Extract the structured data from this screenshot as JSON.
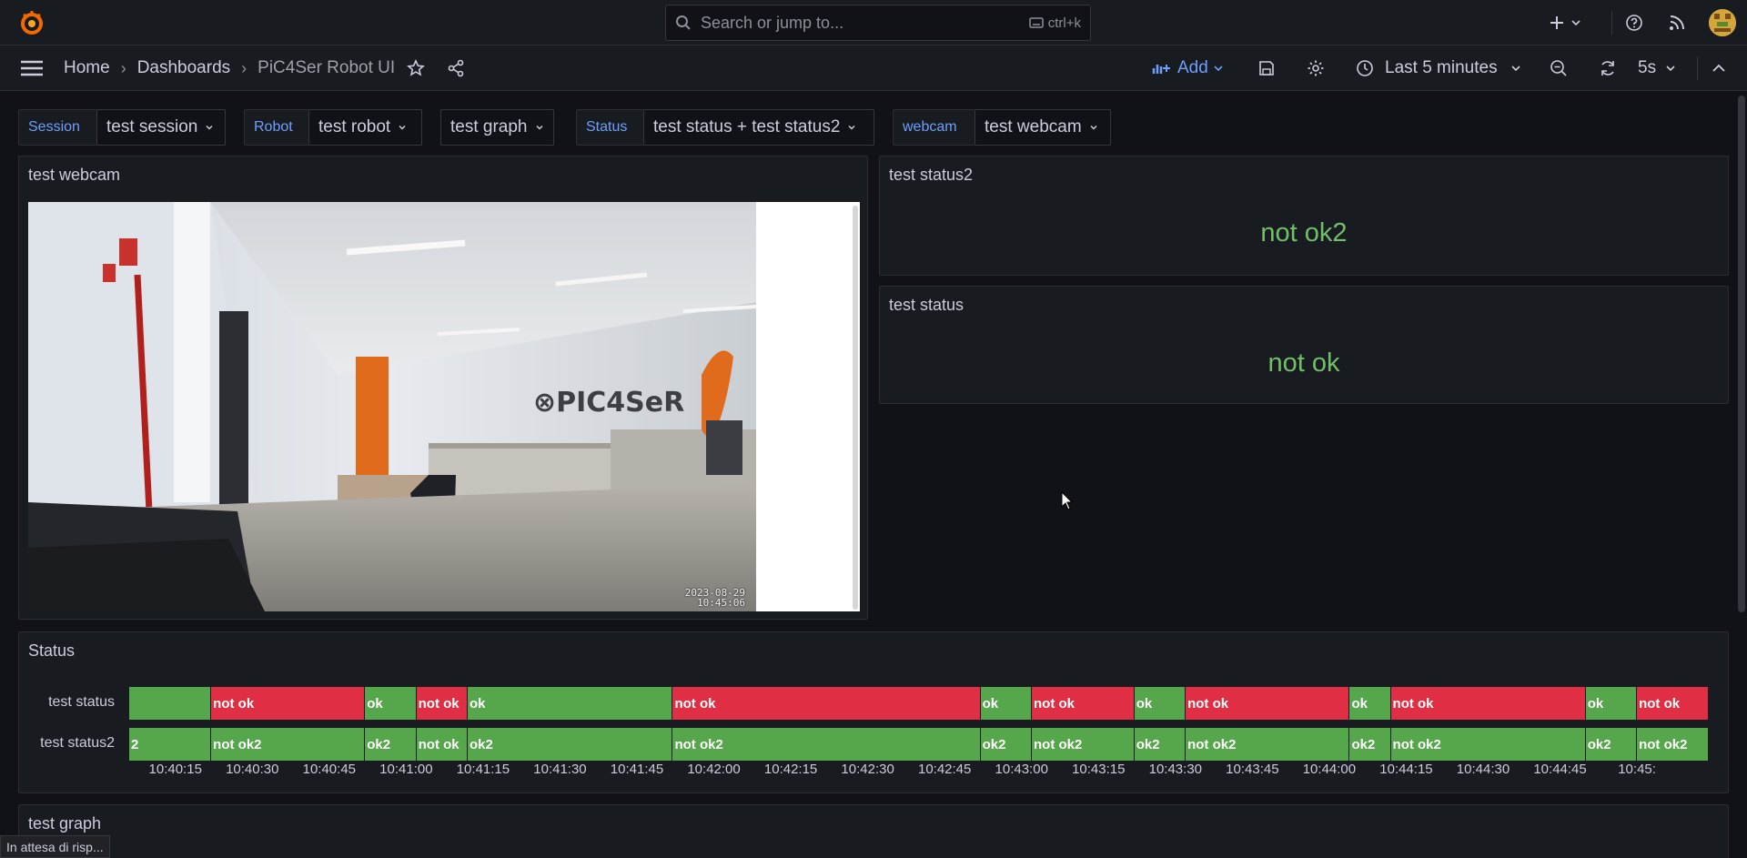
{
  "topbar": {
    "search_placeholder": "Search or jump to...",
    "search_shortcut": "ctrl+k"
  },
  "nav": {
    "breadcrumbs": [
      "Home",
      "Dashboards",
      "PiC4Ser Robot UI"
    ],
    "add_label": "Add",
    "time_range": "Last 5 minutes",
    "refresh_interval": "5s"
  },
  "variables": [
    {
      "label": "Session",
      "value": "test session"
    },
    {
      "label": "Robot",
      "value": "test robot"
    },
    {
      "label": "",
      "value": "test graph"
    },
    {
      "label": "Status",
      "value": "test status + test status2"
    },
    {
      "label": "webcam",
      "value": "test webcam"
    }
  ],
  "panels": {
    "webcam": {
      "title": "test webcam",
      "timestamp_line1": "2023-08-29",
      "timestamp_line2": "10:45:06"
    },
    "status2": {
      "title": "test status2",
      "value": "not ok2"
    },
    "status": {
      "title": "test status",
      "value": "not ok"
    },
    "timeline": {
      "title": "Status"
    },
    "graph": {
      "title": "test graph"
    }
  },
  "chart_data": {
    "type": "state-timeline",
    "title": "Status",
    "x_start": "10:40:06",
    "x_end": "10:45:06",
    "x_ticks": [
      "10:40:15",
      "10:40:30",
      "10:40:45",
      "10:41:00",
      "10:41:15",
      "10:41:30",
      "10:41:45",
      "10:42:00",
      "10:42:15",
      "10:42:30",
      "10:42:45",
      "10:43:00",
      "10:43:15",
      "10:43:30",
      "10:43:45",
      "10:44:00",
      "10:44:15",
      "10:44:30",
      "10:44:45",
      "10:45:"
    ],
    "colors": {
      "ok": "#56a64b",
      "not_ok": "#e02f44",
      "status2": "#56a64b"
    },
    "series": [
      {
        "name": "test status",
        "segments": [
          {
            "start": "10:40:06",
            "end": "10:40:22",
            "label": "",
            "state": "ok"
          },
          {
            "start": "10:40:22",
            "end": "10:40:52",
            "label": "not ok",
            "state": "not_ok"
          },
          {
            "start": "10:40:52",
            "end": "10:41:02",
            "label": "ok",
            "state": "ok"
          },
          {
            "start": "10:41:02",
            "end": "10:41:12",
            "label": "not ok",
            "state": "not_ok"
          },
          {
            "start": "10:41:12",
            "end": "10:41:52",
            "label": "ok",
            "state": "ok"
          },
          {
            "start": "10:41:52",
            "end": "10:42:52",
            "label": "not ok",
            "state": "not_ok"
          },
          {
            "start": "10:42:52",
            "end": "10:43:02",
            "label": "ok",
            "state": "ok"
          },
          {
            "start": "10:43:02",
            "end": "10:43:22",
            "label": "not ok",
            "state": "not_ok"
          },
          {
            "start": "10:43:22",
            "end": "10:43:32",
            "label": "ok",
            "state": "ok"
          },
          {
            "start": "10:43:32",
            "end": "10:44:04",
            "label": "not ok",
            "state": "not_ok"
          },
          {
            "start": "10:44:04",
            "end": "10:44:12",
            "label": "ok",
            "state": "ok"
          },
          {
            "start": "10:44:12",
            "end": "10:44:50",
            "label": "not ok",
            "state": "not_ok"
          },
          {
            "start": "10:44:50",
            "end": "10:45:00",
            "label": "ok",
            "state": "ok"
          },
          {
            "start": "10:45:00",
            "end": "10:45:14",
            "label": "not ok",
            "state": "not_ok"
          }
        ]
      },
      {
        "name": "test status2",
        "segments": [
          {
            "start": "10:40:06",
            "end": "10:40:22",
            "label": "2",
            "state": "status2"
          },
          {
            "start": "10:40:22",
            "end": "10:40:52",
            "label": "not ok2",
            "state": "status2"
          },
          {
            "start": "10:40:52",
            "end": "10:41:02",
            "label": "ok2",
            "state": "status2"
          },
          {
            "start": "10:41:02",
            "end": "10:41:12",
            "label": "not ok",
            "state": "status2"
          },
          {
            "start": "10:41:12",
            "end": "10:41:52",
            "label": "ok2",
            "state": "status2"
          },
          {
            "start": "10:41:52",
            "end": "10:42:52",
            "label": "not ok2",
            "state": "status2"
          },
          {
            "start": "10:42:52",
            "end": "10:43:02",
            "label": "ok2",
            "state": "status2"
          },
          {
            "start": "10:43:02",
            "end": "10:43:22",
            "label": "not ok2",
            "state": "status2"
          },
          {
            "start": "10:43:22",
            "end": "10:43:32",
            "label": "ok2",
            "state": "status2"
          },
          {
            "start": "10:43:32",
            "end": "10:44:04",
            "label": "not ok2",
            "state": "status2"
          },
          {
            "start": "10:44:04",
            "end": "10:44:12",
            "label": "ok2",
            "state": "status2"
          },
          {
            "start": "10:44:12",
            "end": "10:44:50",
            "label": "not ok2",
            "state": "status2"
          },
          {
            "start": "10:44:50",
            "end": "10:45:00",
            "label": "ok2",
            "state": "status2"
          },
          {
            "start": "10:45:00",
            "end": "10:45:14",
            "label": "not ok2",
            "state": "status2"
          }
        ]
      }
    ]
  },
  "browser_status": "In attesa di risp...",
  "icons": [
    "grafana-logo-icon",
    "search-icon",
    "keyboard-icon",
    "plus-icon",
    "help-icon",
    "rss-icon",
    "avatar",
    "menu-icon",
    "star-icon",
    "share-icon",
    "add-panel-icon",
    "save-icon",
    "gear-icon",
    "clock-icon",
    "zoom-out-icon",
    "refresh-icon",
    "collapse-icon"
  ]
}
